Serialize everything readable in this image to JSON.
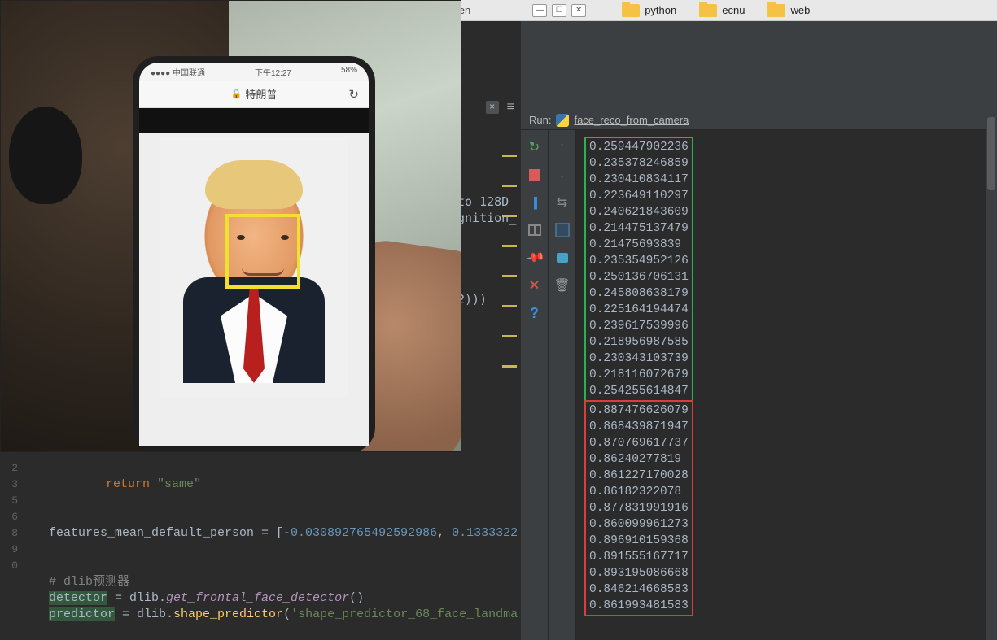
{
  "taskbar": {
    "window_name": "chen",
    "folders": [
      "python",
      "ecnu",
      "web"
    ]
  },
  "camera": {
    "phone_carrier": "中国联通",
    "phone_signal": "●●●●",
    "phone_time": "下午12:27",
    "phone_battery": "58%",
    "url_label": "特朗普",
    "face_box_color": "#f0e030"
  },
  "editor": {
    "tab_close": "×",
    "tab_menu": "≡",
    "upper_snip_1": "to 128D",
    "upper_snip_2": "gnition_",
    "upper_snip_3": "2)))",
    "line_numbers": [
      "2",
      "3",
      "",
      "5",
      "6",
      "",
      "8",
      "9",
      "0"
    ],
    "line_return": "return",
    "line_return_str": "\"same\"",
    "line_features_lhs": "features_mean_default_person = [",
    "line_features_n1": "-0.030892765492592986",
    "line_features_sep": ", ",
    "line_features_n2": "0.1333322",
    "line_comment": "# dlib预测器",
    "line_detector_pre": "detector",
    "line_detector_mid": " = dlib.",
    "line_detector_fn": "get_frontal_face_detector",
    "line_detector_suf": "()",
    "line_predictor_pre": "predictor",
    "line_predictor_mid": " = dlib.",
    "line_predictor_fn": "shape_predictor",
    "line_predictor_arg": "'shape_predictor_68_face_landma"
  },
  "run": {
    "label": "Run:",
    "config_name": "face_reco_from_camera",
    "green_values": [
      "0.259447902236",
      "0.235378246859",
      "0.230410834117",
      "0.223649110297",
      "0.240621843609",
      "0.214475137479",
      "0.21475693839",
      "0.235354952126",
      "0.250136706131",
      "0.245808638179",
      "0.225164194474",
      "0.239617539996",
      "0.218956987585",
      "0.230343103739",
      "0.218116072679",
      "0.254255614847"
    ],
    "red_values": [
      "0.887476626079",
      "0.868439871947",
      "0.870769617737",
      "0.86240277819",
      "0.861227170028",
      "0.86182322078",
      "0.877831991916",
      "0.860099961273",
      "0.896910159368",
      "0.891555167717",
      "0.893195086668",
      "0.846214668583",
      "0.861993481583"
    ]
  }
}
